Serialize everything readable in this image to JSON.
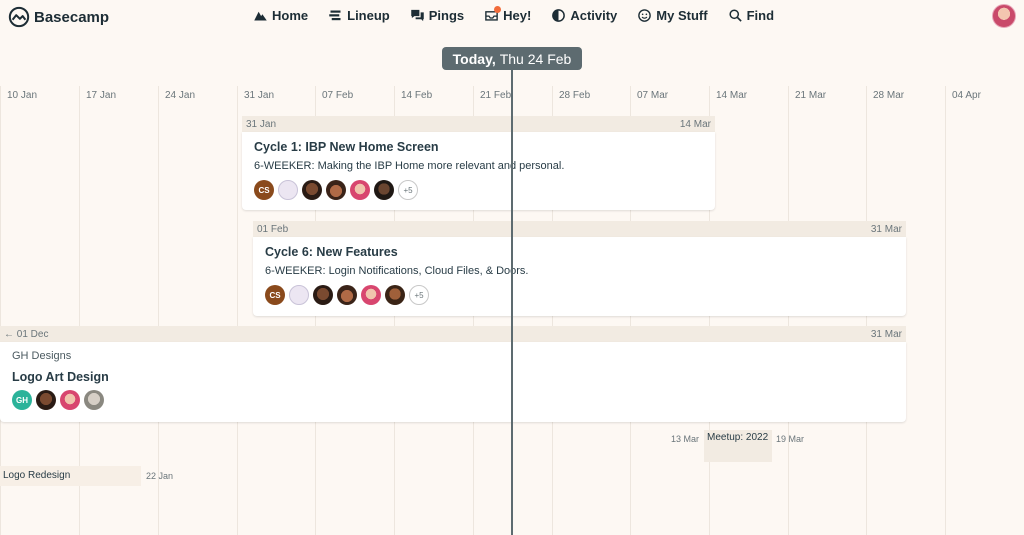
{
  "app": {
    "name": "Basecamp"
  },
  "nav": {
    "home": "Home",
    "lineup": "Lineup",
    "pings": "Pings",
    "hey": "Hey!",
    "activity": "Activity",
    "my_stuff": "My Stuff",
    "find": "Find"
  },
  "today": {
    "prefix": "Today,",
    "date": "Thu 24 Feb"
  },
  "columns": [
    "10 Jan",
    "17 Jan",
    "24 Jan",
    "31 Jan",
    "07 Feb",
    "14 Feb",
    "21 Feb",
    "28 Feb",
    "07 Mar",
    "14 Mar",
    "21 Mar",
    "28 Mar",
    "04 Apr"
  ],
  "projects": [
    {
      "start": "31 Jan",
      "end": "14 Mar",
      "title": "Cycle 1: IBP New Home Screen",
      "desc": "6-WEEKER: Making the IBP Home more relevant and personal.",
      "avatars": [
        "CS",
        "",
        "",
        "",
        "",
        ""
      ],
      "more": "+5"
    },
    {
      "start": "01 Feb",
      "end": "31 Mar",
      "title": "Cycle 6: New Features",
      "desc": "6-WEEKER: Login Notifications, Cloud Files, & Doors.",
      "avatars": [
        "CS",
        "",
        "",
        "",
        "",
        ""
      ],
      "more": "+5"
    },
    {
      "start": "← 01 Dec",
      "end": "31 Mar",
      "subtitle": "GH Designs",
      "title": "Logo Art Design",
      "avatars": [
        "GH",
        "",
        "",
        ""
      ]
    }
  ],
  "meetup": {
    "start": "13 Mar",
    "label": "Meetup: 2022",
    "end": "19 Mar"
  },
  "logo_redesign": {
    "label": "Logo Redesign",
    "end": "22 Jan"
  },
  "colors": {
    "background": "#fdf8f3",
    "accent": "#283c46",
    "today_pill": "#5d6b70",
    "bar_head": "#f2ebe2"
  }
}
